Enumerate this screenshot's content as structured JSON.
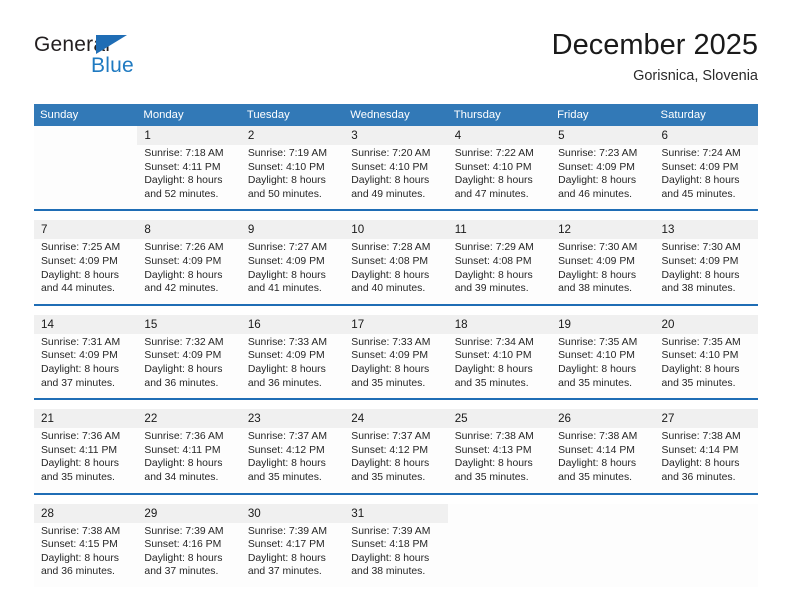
{
  "brand": {
    "name_top": "General",
    "name_bottom": "Blue",
    "top_color": "#231f20",
    "bottom_color": "#1f7ac1",
    "triangle_color": "#1f6db5"
  },
  "header": {
    "title": "December 2025",
    "subtitle": "Gorisnica, Slovenia"
  },
  "theme": {
    "header_row_bg": "#3279b7",
    "header_row_text": "#ffffff",
    "week_separator": "#1f6db5",
    "daynum_bg": "#f0f0f0",
    "cell_bg": "#fdfdfd"
  },
  "weekdays": [
    "Sunday",
    "Monday",
    "Tuesday",
    "Wednesday",
    "Thursday",
    "Friday",
    "Saturday"
  ],
  "labels": {
    "sunrise_prefix": "Sunrise:",
    "sunset_prefix": "Sunset:",
    "daylight_prefix": "Daylight:"
  },
  "weeks": [
    [
      {
        "day": "",
        "empty": true
      },
      {
        "day": "1",
        "sunrise": "Sunrise: 7:18 AM",
        "sunset": "Sunset: 4:11 PM",
        "daylight_1": "Daylight: 8 hours",
        "daylight_2": "and 52 minutes."
      },
      {
        "day": "2",
        "sunrise": "Sunrise: 7:19 AM",
        "sunset": "Sunset: 4:10 PM",
        "daylight_1": "Daylight: 8 hours",
        "daylight_2": "and 50 minutes."
      },
      {
        "day": "3",
        "sunrise": "Sunrise: 7:20 AM",
        "sunset": "Sunset: 4:10 PM",
        "daylight_1": "Daylight: 8 hours",
        "daylight_2": "and 49 minutes."
      },
      {
        "day": "4",
        "sunrise": "Sunrise: 7:22 AM",
        "sunset": "Sunset: 4:10 PM",
        "daylight_1": "Daylight: 8 hours",
        "daylight_2": "and 47 minutes."
      },
      {
        "day": "5",
        "sunrise": "Sunrise: 7:23 AM",
        "sunset": "Sunset: 4:09 PM",
        "daylight_1": "Daylight: 8 hours",
        "daylight_2": "and 46 minutes."
      },
      {
        "day": "6",
        "sunrise": "Sunrise: 7:24 AM",
        "sunset": "Sunset: 4:09 PM",
        "daylight_1": "Daylight: 8 hours",
        "daylight_2": "and 45 minutes."
      }
    ],
    [
      {
        "day": "7",
        "sunrise": "Sunrise: 7:25 AM",
        "sunset": "Sunset: 4:09 PM",
        "daylight_1": "Daylight: 8 hours",
        "daylight_2": "and 44 minutes."
      },
      {
        "day": "8",
        "sunrise": "Sunrise: 7:26 AM",
        "sunset": "Sunset: 4:09 PM",
        "daylight_1": "Daylight: 8 hours",
        "daylight_2": "and 42 minutes."
      },
      {
        "day": "9",
        "sunrise": "Sunrise: 7:27 AM",
        "sunset": "Sunset: 4:09 PM",
        "daylight_1": "Daylight: 8 hours",
        "daylight_2": "and 41 minutes."
      },
      {
        "day": "10",
        "sunrise": "Sunrise: 7:28 AM",
        "sunset": "Sunset: 4:08 PM",
        "daylight_1": "Daylight: 8 hours",
        "daylight_2": "and 40 minutes."
      },
      {
        "day": "11",
        "sunrise": "Sunrise: 7:29 AM",
        "sunset": "Sunset: 4:08 PM",
        "daylight_1": "Daylight: 8 hours",
        "daylight_2": "and 39 minutes."
      },
      {
        "day": "12",
        "sunrise": "Sunrise: 7:30 AM",
        "sunset": "Sunset: 4:09 PM",
        "daylight_1": "Daylight: 8 hours",
        "daylight_2": "and 38 minutes."
      },
      {
        "day": "13",
        "sunrise": "Sunrise: 7:30 AM",
        "sunset": "Sunset: 4:09 PM",
        "daylight_1": "Daylight: 8 hours",
        "daylight_2": "and 38 minutes."
      }
    ],
    [
      {
        "day": "14",
        "sunrise": "Sunrise: 7:31 AM",
        "sunset": "Sunset: 4:09 PM",
        "daylight_1": "Daylight: 8 hours",
        "daylight_2": "and 37 minutes."
      },
      {
        "day": "15",
        "sunrise": "Sunrise: 7:32 AM",
        "sunset": "Sunset: 4:09 PM",
        "daylight_1": "Daylight: 8 hours",
        "daylight_2": "and 36 minutes."
      },
      {
        "day": "16",
        "sunrise": "Sunrise: 7:33 AM",
        "sunset": "Sunset: 4:09 PM",
        "daylight_1": "Daylight: 8 hours",
        "daylight_2": "and 36 minutes."
      },
      {
        "day": "17",
        "sunrise": "Sunrise: 7:33 AM",
        "sunset": "Sunset: 4:09 PM",
        "daylight_1": "Daylight: 8 hours",
        "daylight_2": "and 35 minutes."
      },
      {
        "day": "18",
        "sunrise": "Sunrise: 7:34 AM",
        "sunset": "Sunset: 4:10 PM",
        "daylight_1": "Daylight: 8 hours",
        "daylight_2": "and 35 minutes."
      },
      {
        "day": "19",
        "sunrise": "Sunrise: 7:35 AM",
        "sunset": "Sunset: 4:10 PM",
        "daylight_1": "Daylight: 8 hours",
        "daylight_2": "and 35 minutes."
      },
      {
        "day": "20",
        "sunrise": "Sunrise: 7:35 AM",
        "sunset": "Sunset: 4:10 PM",
        "daylight_1": "Daylight: 8 hours",
        "daylight_2": "and 35 minutes."
      }
    ],
    [
      {
        "day": "21",
        "sunrise": "Sunrise: 7:36 AM",
        "sunset": "Sunset: 4:11 PM",
        "daylight_1": "Daylight: 8 hours",
        "daylight_2": "and 35 minutes."
      },
      {
        "day": "22",
        "sunrise": "Sunrise: 7:36 AM",
        "sunset": "Sunset: 4:11 PM",
        "daylight_1": "Daylight: 8 hours",
        "daylight_2": "and 34 minutes."
      },
      {
        "day": "23",
        "sunrise": "Sunrise: 7:37 AM",
        "sunset": "Sunset: 4:12 PM",
        "daylight_1": "Daylight: 8 hours",
        "daylight_2": "and 35 minutes."
      },
      {
        "day": "24",
        "sunrise": "Sunrise: 7:37 AM",
        "sunset": "Sunset: 4:12 PM",
        "daylight_1": "Daylight: 8 hours",
        "daylight_2": "and 35 minutes."
      },
      {
        "day": "25",
        "sunrise": "Sunrise: 7:38 AM",
        "sunset": "Sunset: 4:13 PM",
        "daylight_1": "Daylight: 8 hours",
        "daylight_2": "and 35 minutes."
      },
      {
        "day": "26",
        "sunrise": "Sunrise: 7:38 AM",
        "sunset": "Sunset: 4:14 PM",
        "daylight_1": "Daylight: 8 hours",
        "daylight_2": "and 35 minutes."
      },
      {
        "day": "27",
        "sunrise": "Sunrise: 7:38 AM",
        "sunset": "Sunset: 4:14 PM",
        "daylight_1": "Daylight: 8 hours",
        "daylight_2": "and 36 minutes."
      }
    ],
    [
      {
        "day": "28",
        "sunrise": "Sunrise: 7:38 AM",
        "sunset": "Sunset: 4:15 PM",
        "daylight_1": "Daylight: 8 hours",
        "daylight_2": "and 36 minutes."
      },
      {
        "day": "29",
        "sunrise": "Sunrise: 7:39 AM",
        "sunset": "Sunset: 4:16 PM",
        "daylight_1": "Daylight: 8 hours",
        "daylight_2": "and 37 minutes."
      },
      {
        "day": "30",
        "sunrise": "Sunrise: 7:39 AM",
        "sunset": "Sunset: 4:17 PM",
        "daylight_1": "Daylight: 8 hours",
        "daylight_2": "and 37 minutes."
      },
      {
        "day": "31",
        "sunrise": "Sunrise: 7:39 AM",
        "sunset": "Sunset: 4:18 PM",
        "daylight_1": "Daylight: 8 hours",
        "daylight_2": "and 38 minutes."
      },
      {
        "day": "",
        "empty": true
      },
      {
        "day": "",
        "empty": true
      },
      {
        "day": "",
        "empty": true
      }
    ]
  ]
}
